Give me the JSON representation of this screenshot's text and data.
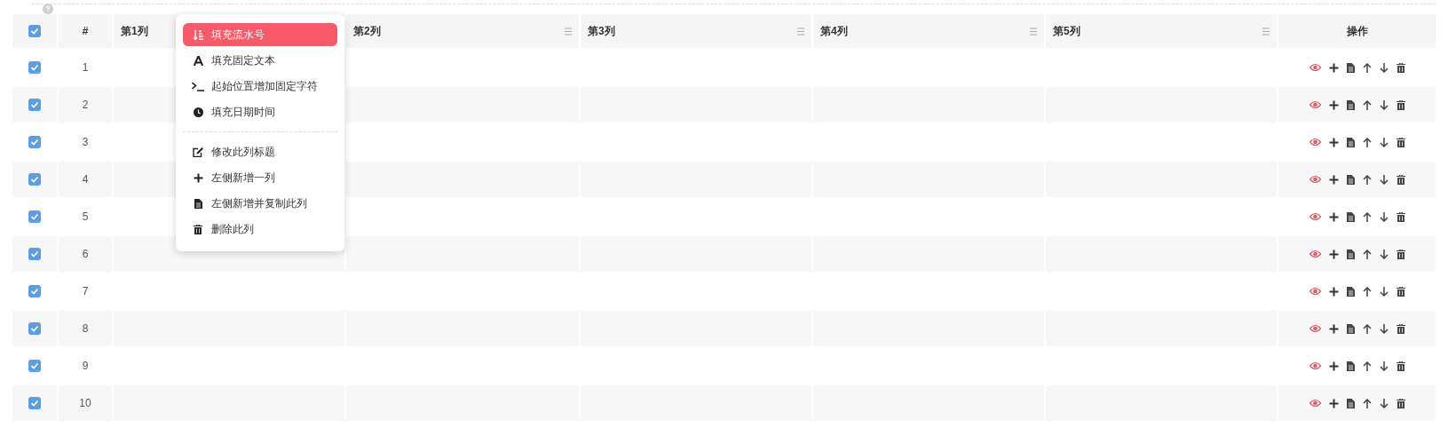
{
  "table": {
    "select_all": {
      "checked": true
    },
    "columns": [
      {
        "label": "#"
      },
      {
        "label": "第1列"
      },
      {
        "label": "第2列",
        "menu_icon": true
      },
      {
        "label": "第3列",
        "menu_icon": true
      },
      {
        "label": "第4列",
        "menu_icon": true
      },
      {
        "label": "第5列",
        "menu_icon": true
      },
      {
        "label": "操作"
      }
    ],
    "rows": [
      {
        "number": "1",
        "checked": true
      },
      {
        "number": "2",
        "checked": true
      },
      {
        "number": "3",
        "checked": true
      },
      {
        "number": "4",
        "checked": true
      },
      {
        "number": "5",
        "checked": true
      },
      {
        "number": "6",
        "checked": true
      },
      {
        "number": "7",
        "checked": true
      },
      {
        "number": "8",
        "checked": true
      },
      {
        "number": "9",
        "checked": true
      },
      {
        "number": "10",
        "checked": true
      }
    ]
  },
  "context_menu": {
    "groups": [
      [
        {
          "label": "填充流水号",
          "selected": true
        },
        {
          "label": "填充固定文本",
          "selected": false
        },
        {
          "label": "起始位置增加固定字符",
          "selected": false
        },
        {
          "label": "填充日期时间",
          "selected": false
        }
      ],
      [
        {
          "label": "修改此列标题",
          "selected": false
        },
        {
          "label": "左侧新增一列",
          "selected": false
        },
        {
          "label": "左侧新增并复制此列",
          "selected": false
        },
        {
          "label": "删除此列",
          "selected": false
        }
      ]
    ]
  }
}
